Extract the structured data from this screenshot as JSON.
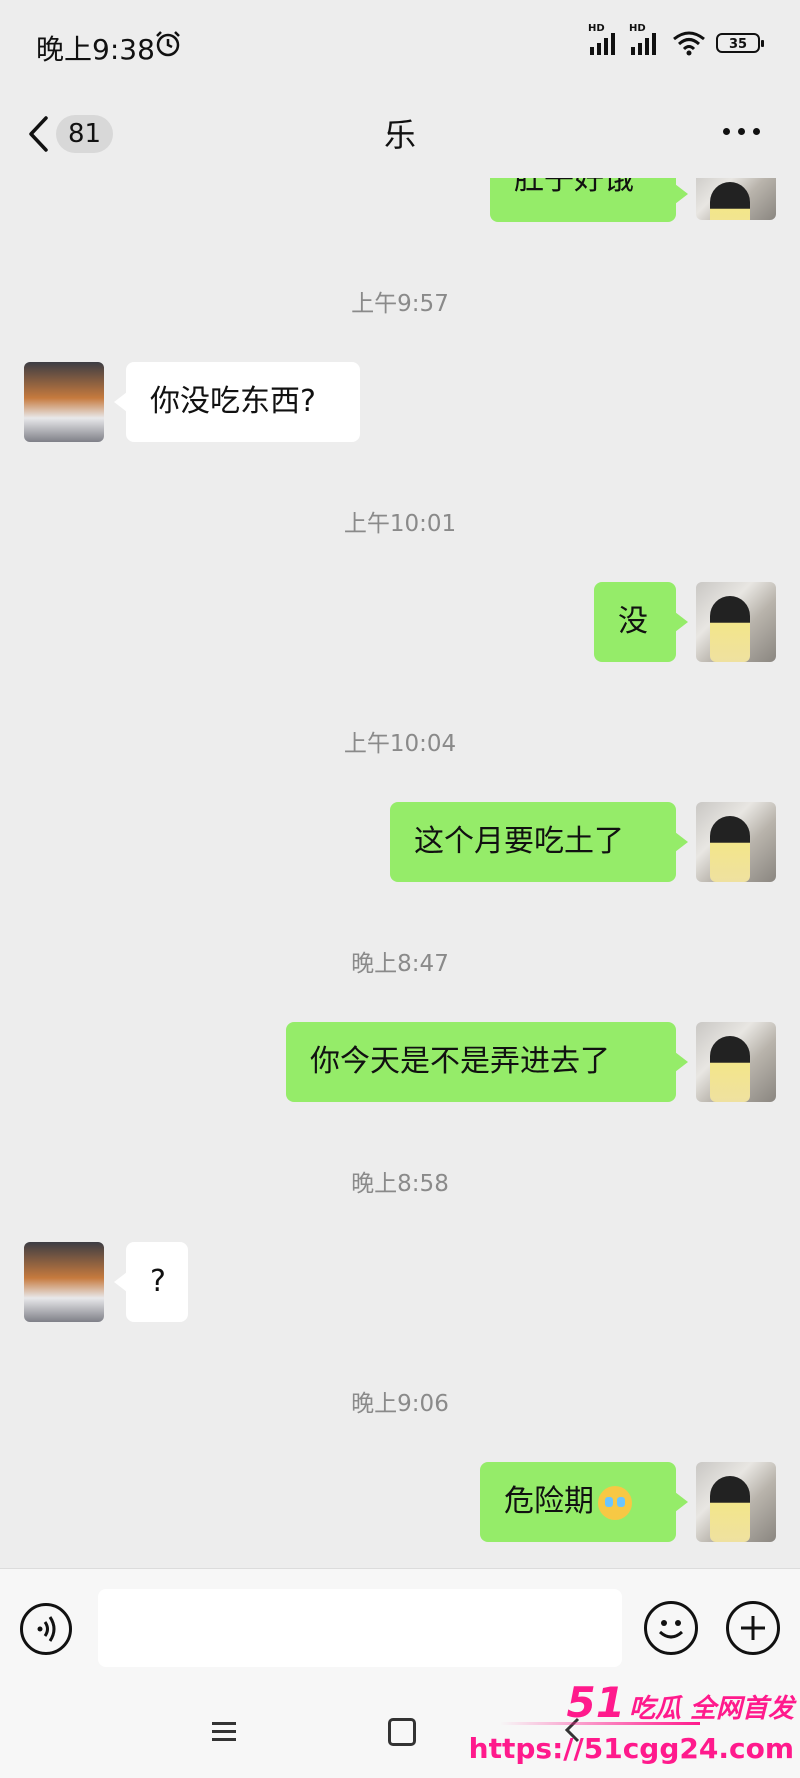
{
  "status_bar": {
    "time": "晚上9:38",
    "hd_label": "HD",
    "battery": "35"
  },
  "header": {
    "unread_count": "81",
    "title": "乐"
  },
  "messages": [
    {
      "side": "sent",
      "text": "肚子好饿"
    },
    {
      "timestamp": "上午9:57"
    },
    {
      "side": "recv",
      "text": "你没吃东西?"
    },
    {
      "timestamp": "上午10:01"
    },
    {
      "side": "sent",
      "text": "没"
    },
    {
      "timestamp": "上午10:04"
    },
    {
      "side": "sent",
      "text": "这个月要吃土了"
    },
    {
      "timestamp": "晚上8:47"
    },
    {
      "side": "sent",
      "text": "你今天是不是弄进去了"
    },
    {
      "timestamp": "晚上8:58"
    },
    {
      "side": "recv",
      "text": "?"
    },
    {
      "timestamp": "晚上9:06"
    },
    {
      "side": "sent",
      "text": "危险期",
      "emoji": "crying-face-emoji"
    }
  ],
  "input": {
    "value": "",
    "placeholder": ""
  },
  "icons": {
    "voice": "voice-icon",
    "emoji": "emoji-icon",
    "plus": "plus-icon",
    "back": "chevron-left-icon",
    "more": "more-icon"
  },
  "watermark": {
    "number": "51",
    "text": "吃瓜 全网首发",
    "url": "https://51cgg24.com"
  },
  "colors": {
    "background": "#ededed",
    "sent_bubble": "#95ec69",
    "received_bubble": "#ffffff",
    "timestamp": "#8a8a8a",
    "watermark": "#ff1a8c"
  }
}
